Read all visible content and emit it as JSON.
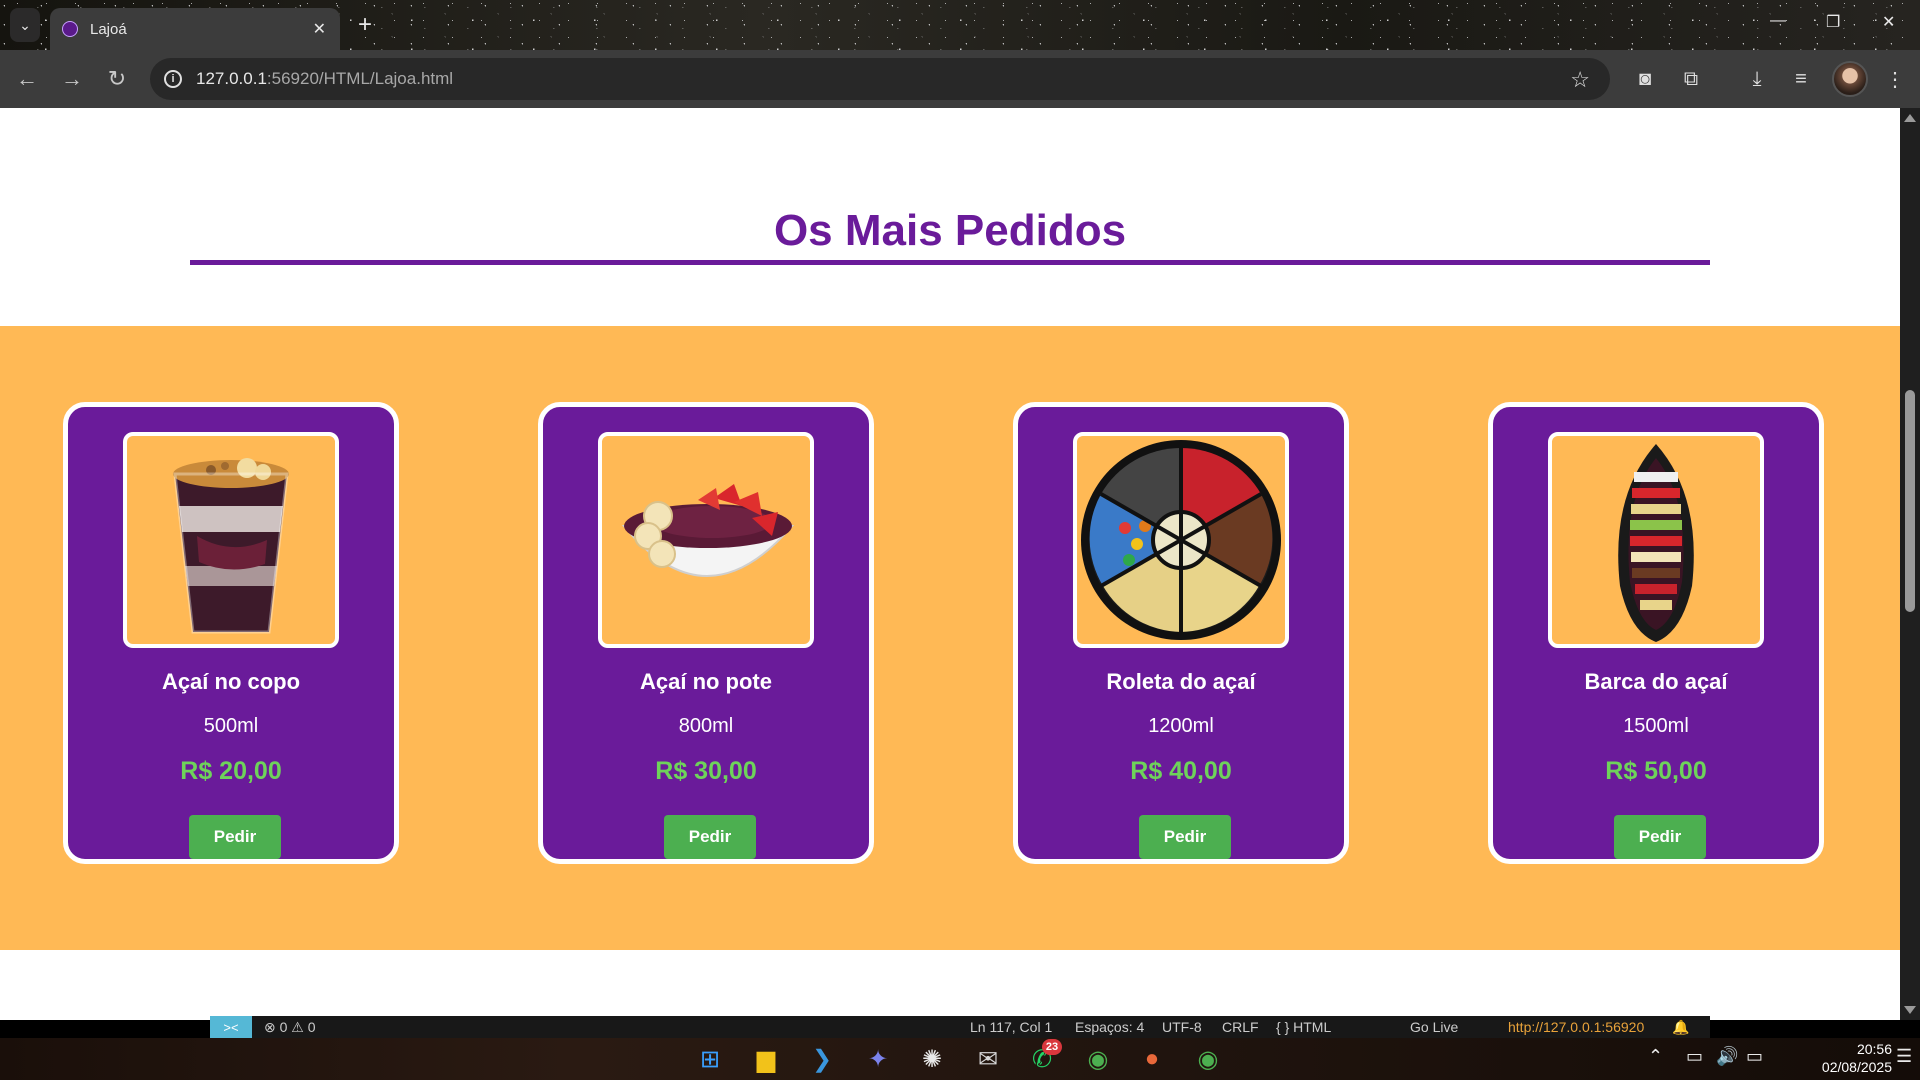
{
  "browser": {
    "tab_title": "Lajoá",
    "url_host": "127.0.0.1",
    "url_rest": ":56920/HTML/Lajoa.html"
  },
  "section": {
    "title": "Os Mais Pedidos"
  },
  "products": [
    {
      "name": "Açaí no copo",
      "volume": "500ml",
      "price": "R$ 20,00",
      "button": "Pedir"
    },
    {
      "name": "Açaí no pote",
      "volume": "800ml",
      "price": "R$ 30,00",
      "button": "Pedir"
    },
    {
      "name": "Roleta do açaí",
      "volume": "1200ml",
      "price": "R$ 40,00",
      "button": "Pedir"
    },
    {
      "name": "Barca do açaí",
      "volume": "1500ml",
      "price": "R$ 50,00",
      "button": "Pedir"
    }
  ],
  "colors": {
    "purple": "#6a1b9a",
    "orange": "#ffb955",
    "green_button": "#4caf50",
    "price_green": "#6ed35a"
  },
  "vscode_status": {
    "problems": "⊗ 0 ⚠ 0",
    "position": "Ln 117, Col 1",
    "spaces": "Espaços: 4",
    "encoding": "UTF-8",
    "eol": "CRLF",
    "language": "{ } HTML",
    "go_live": "Go Live",
    "server": "http://127.0.0.1:56920"
  },
  "taskbar": {
    "whatsapp_badge": "23",
    "time": "20:56",
    "date": "02/08/2025"
  }
}
